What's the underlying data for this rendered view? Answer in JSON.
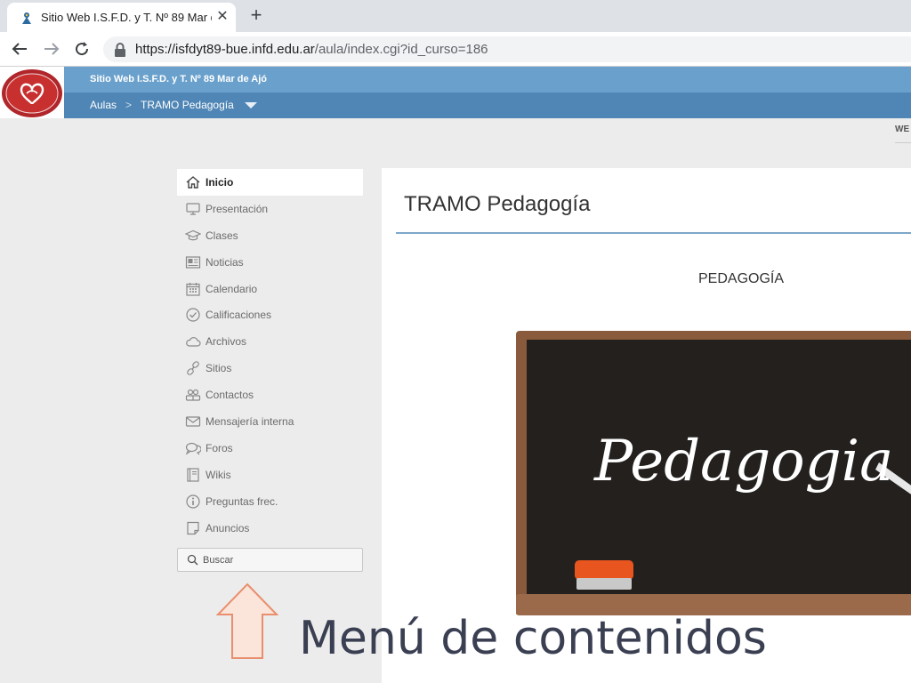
{
  "browser": {
    "tab_title": "Sitio Web I.S.F.D. y T. Nº 89 Mar d",
    "url_host": "https://isfdyt89-bue.infd.edu.ar",
    "url_path": "/aula/index.cgi?id_curso=186"
  },
  "site": {
    "title": "Sitio Web I.S.F.D. y T. Nº 89 Mar de Ajó",
    "breadcrumb": [
      "Aulas",
      "TRAMO Pedagogía"
    ],
    "topright_label": "WE"
  },
  "menu": {
    "items": [
      {
        "label": "Inicio",
        "icon": "home-icon",
        "active": true
      },
      {
        "label": "Presentación",
        "icon": "monitor-icon"
      },
      {
        "label": "Clases",
        "icon": "graduation-cap-icon"
      },
      {
        "label": "Noticias",
        "icon": "newspaper-icon"
      },
      {
        "label": "Calendario",
        "icon": "calendar-icon"
      },
      {
        "label": "Calificaciones",
        "icon": "check-circle-icon"
      },
      {
        "label": "Archivos",
        "icon": "cloud-icon"
      },
      {
        "label": "Sitios",
        "icon": "link-icon"
      },
      {
        "label": "Contactos",
        "icon": "people-icon"
      },
      {
        "label": "Mensajería interna",
        "icon": "envelope-icon"
      },
      {
        "label": "Foros",
        "icon": "chat-bubbles-icon"
      },
      {
        "label": "Wikis",
        "icon": "book-icon"
      },
      {
        "label": "Preguntas frec.",
        "icon": "info-icon"
      },
      {
        "label": "Anuncios",
        "icon": "note-icon"
      }
    ],
    "search_placeholder": "Buscar"
  },
  "main": {
    "course_title": "TRAMO Pedagogía",
    "subject_heading": "PEDAGOGÍA",
    "board_text": "Pedagogia"
  },
  "annotation": {
    "text": "Menú de contenidos"
  },
  "colors": {
    "header_top": "#6aa0cc",
    "header_bottom": "#4f86b5",
    "annotation_text": "#3a3f52",
    "arrow": "#e88f6e"
  }
}
